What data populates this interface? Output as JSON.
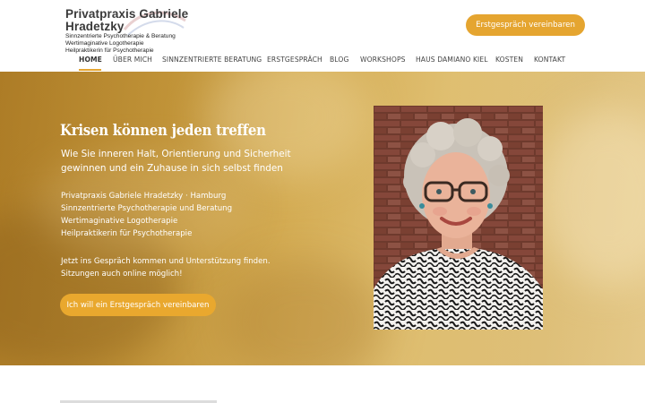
{
  "header": {
    "logo_title": "Privatpraxis Gabriele Hradetzky",
    "logo_lines": [
      "Sinnzentrierte Psychotherapie & Beratung",
      "Wertimaginative Logotherapie",
      "Heilpraktikerin für Psychotherapie"
    ],
    "cta_label": "Erstgespräch vereinbaren"
  },
  "nav": {
    "items": [
      "HOME",
      "ÜBER MICH",
      "SINNZENTRIERTE BERATUNG",
      "ERSTGESPRÄCH",
      "BLOG",
      "WORKSHOPS",
      "HAUS DAMIANO KIEL",
      "KOSTEN",
      "KONTAKT"
    ],
    "active_index": 0
  },
  "hero": {
    "title": "Krisen können jeden treffen",
    "lead": "Wie Sie inneren Halt, Orientierung und Sicherheit gewinnen und ein Zuhause in sich selbst finden",
    "lines": [
      "Privatpraxis Gabriele Hradetzky · Hamburg",
      "Sinnzentrierte Psychotherapie und Beratung",
      "Wertimaginative Logotherapie",
      "Heilpraktikerin für Psychotherapie"
    ],
    "note_lines": [
      "Jetzt ins Gespräch kommen und Unterstützung finden.",
      "Sitzungen auch online möglich!"
    ],
    "cta_label": "Ich will ein Erstgespräch vereinbaren"
  },
  "colors": {
    "accent": "#e5a530",
    "hero_dark": "#b9892d",
    "hero_light": "#e4c888"
  },
  "icons": {
    "portrait": "portrait-photo"
  }
}
